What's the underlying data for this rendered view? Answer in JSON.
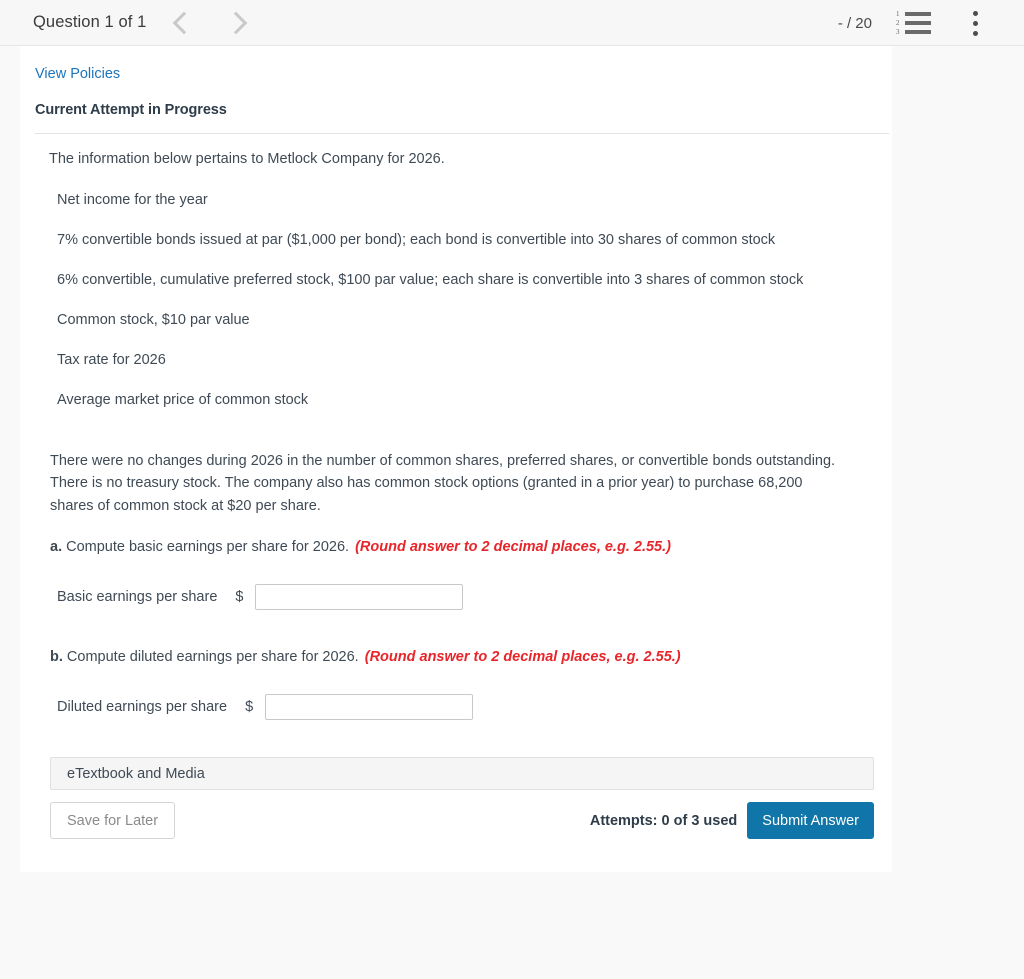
{
  "topbar": {
    "question_label": "Question 1 of 1",
    "prev_icon": "chevron-left-icon",
    "next_icon": "chevron-right-icon",
    "score": "- / 20",
    "list_icon": "numbered-list-icon",
    "list_numbers": [
      "1",
      "2",
      "3"
    ],
    "menu_icon": "kebab-menu-icon"
  },
  "card": {
    "view_policies": "View Policies",
    "attempt_status": "Current Attempt in Progress",
    "intro": "The information below pertains to Metlock Company for 2026.",
    "facts": [
      "Net income for the year",
      "7% convertible bonds issued at par ($1,000 per bond); each bond is convertible into 30 shares of common stock",
      "6% convertible, cumulative preferred stock, $100 par value; each share is convertible into 3 shares of common stock",
      "Common stock, $10 par value",
      "Tax rate for 2026",
      "Average market price of common stock"
    ],
    "paragraph": "There were no changes during 2026 in the number of common shares, preferred shares, or convertible bonds outstanding. There is no treasury stock. The company also has common stock options (granted in a prior year) to purchase 68,200 shares of common stock at $20 per share.",
    "parts": [
      {
        "lead": "a.",
        "question": " Compute basic earnings per share for 2026. ",
        "hint": "(Round answer to 2 decimal places, e.g. 2.55.)",
        "answer_label": "Basic earnings per share",
        "currency": "$",
        "answer_value": "",
        "answer_placeholder": ""
      },
      {
        "lead": "b.",
        "question": " Compute diluted earnings per share for 2026. ",
        "hint": "(Round answer to 2 decimal places, e.g. 2.55.)",
        "answer_label": "Diluted earnings per share",
        "currency": "$",
        "answer_value": "",
        "answer_placeholder": ""
      }
    ],
    "etextbook": "eTextbook and Media",
    "save_for_later": "Save for Later",
    "attempts": "Attempts: 0 of 3 used",
    "submit": "Submit Answer"
  },
  "colors": {
    "link": "#1c75bc",
    "hint_red": "#e8252a",
    "submit_blue": "#1075a8",
    "text": "#3f4a55",
    "page_bg": "#f9f9f9"
  }
}
